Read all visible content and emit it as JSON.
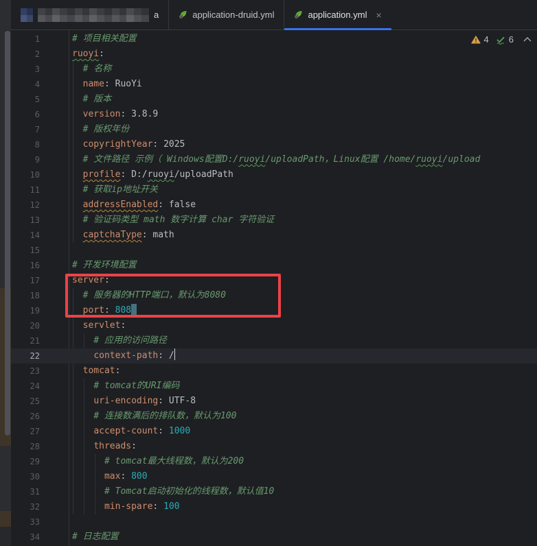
{
  "colors": {
    "editor_bg": "#1e1f22",
    "tab_accent": "#3574f0",
    "annotation_red": "#ee4247",
    "spring_green": "#6db33f",
    "key_orange": "#cf8e6d",
    "number_cyan": "#2aacb8",
    "comment_green": "#689a70",
    "warning_yellow": "#d8a04a",
    "typo_check_green": "#57a05a"
  },
  "tabs": {
    "censored": {
      "trailing_text": "a"
    },
    "items": [
      {
        "label": "application-druid.yml",
        "active": false
      },
      {
        "label": "application.yml",
        "active": true
      }
    ],
    "close_label": "×"
  },
  "inspections": {
    "warnings": "4",
    "typos": "6"
  },
  "code": {
    "lines": [
      {
        "n": 1,
        "pad": 0,
        "segs": [
          {
            "t": "# 项目相关配置",
            "c": "comment"
          }
        ]
      },
      {
        "n": 2,
        "pad": 0,
        "segs": [
          {
            "t": "ruoyi",
            "c": "key",
            "u": "typo"
          },
          {
            "t": ":",
            "c": "punct"
          }
        ]
      },
      {
        "n": 3,
        "pad": 2,
        "segs": [
          {
            "t": "# 名称",
            "c": "comment"
          }
        ]
      },
      {
        "n": 4,
        "pad": 2,
        "segs": [
          {
            "t": "name",
            "c": "key"
          },
          {
            "t": ": ",
            "c": "punct"
          },
          {
            "t": "RuoYi",
            "c": "str"
          }
        ]
      },
      {
        "n": 5,
        "pad": 2,
        "segs": [
          {
            "t": "# 版本",
            "c": "comment"
          }
        ]
      },
      {
        "n": 6,
        "pad": 2,
        "segs": [
          {
            "t": "version",
            "c": "key"
          },
          {
            "t": ": ",
            "c": "punct"
          },
          {
            "t": "3.8.9",
            "c": "str"
          }
        ]
      },
      {
        "n": 7,
        "pad": 2,
        "segs": [
          {
            "t": "# 版权年份",
            "c": "comment"
          }
        ]
      },
      {
        "n": 8,
        "pad": 2,
        "segs": [
          {
            "t": "copyrightYear",
            "c": "key"
          },
          {
            "t": ": ",
            "c": "punct"
          },
          {
            "t": "2025",
            "c": "str"
          }
        ]
      },
      {
        "n": 9,
        "pad": 2,
        "segs": [
          {
            "t": "# 文件路径 示例（ Windows配置D:/",
            "c": "comment"
          },
          {
            "t": "ruoyi",
            "c": "comment",
            "u": "typo"
          },
          {
            "t": "/uploadPath，Linux配置 /home/",
            "c": "comment"
          },
          {
            "t": "ruoyi",
            "c": "comment",
            "u": "typo"
          },
          {
            "t": "/upload",
            "c": "comment"
          }
        ]
      },
      {
        "n": 10,
        "pad": 2,
        "segs": [
          {
            "t": "profile",
            "c": "key",
            "u": "warn"
          },
          {
            "t": ": ",
            "c": "punct"
          },
          {
            "t": "D:/",
            "c": "str"
          },
          {
            "t": "ruoyi",
            "c": "str",
            "u": "typo"
          },
          {
            "t": "/uploadPath",
            "c": "str"
          }
        ]
      },
      {
        "n": 11,
        "pad": 2,
        "segs": [
          {
            "t": "# 获取ip地址开关",
            "c": "comment"
          }
        ]
      },
      {
        "n": 12,
        "pad": 2,
        "segs": [
          {
            "t": "addressEnabled",
            "c": "key",
            "u": "warn"
          },
          {
            "t": ": ",
            "c": "punct"
          },
          {
            "t": "false",
            "c": "str"
          }
        ]
      },
      {
        "n": 13,
        "pad": 2,
        "segs": [
          {
            "t": "# 验证码类型 math 数字计算 char 字符验证",
            "c": "comment"
          }
        ]
      },
      {
        "n": 14,
        "pad": 2,
        "segs": [
          {
            "t": "captchaType",
            "c": "key",
            "u": "warn"
          },
          {
            "t": ": ",
            "c": "punct"
          },
          {
            "t": "math",
            "c": "str"
          }
        ]
      },
      {
        "n": 15,
        "pad": 0,
        "segs": []
      },
      {
        "n": 16,
        "pad": 0,
        "segs": [
          {
            "t": "# 开发环境配置",
            "c": "comment"
          }
        ]
      },
      {
        "n": 17,
        "pad": 0,
        "segs": [
          {
            "t": "server",
            "c": "key"
          },
          {
            "t": ":",
            "c": "punct"
          }
        ]
      },
      {
        "n": 18,
        "pad": 2,
        "segs": [
          {
            "t": "# 服务器的HTTP端口，默认为8080",
            "c": "comment"
          }
        ]
      },
      {
        "n": 19,
        "pad": 2,
        "sel": true,
        "segs": [
          {
            "t": "port",
            "c": "key"
          },
          {
            "t": ": ",
            "c": "punct"
          },
          {
            "t": "808",
            "c": "num"
          }
        ]
      },
      {
        "n": 20,
        "pad": 2,
        "segs": [
          {
            "t": "servlet",
            "c": "key"
          },
          {
            "t": ":",
            "c": "punct"
          }
        ]
      },
      {
        "n": 21,
        "pad": 4,
        "segs": [
          {
            "t": "# 应用的访问路径",
            "c": "comment"
          }
        ]
      },
      {
        "n": 22,
        "pad": 4,
        "current": true,
        "caret": true,
        "segs": [
          {
            "t": "context-path",
            "c": "key"
          },
          {
            "t": ": ",
            "c": "punct"
          },
          {
            "t": "/",
            "c": "str"
          }
        ]
      },
      {
        "n": 23,
        "pad": 2,
        "segs": [
          {
            "t": "tomcat",
            "c": "key"
          },
          {
            "t": ":",
            "c": "punct"
          }
        ]
      },
      {
        "n": 24,
        "pad": 4,
        "segs": [
          {
            "t": "# tomcat的URI编码",
            "c": "comment"
          }
        ]
      },
      {
        "n": 25,
        "pad": 4,
        "segs": [
          {
            "t": "uri-encoding",
            "c": "key"
          },
          {
            "t": ": ",
            "c": "punct"
          },
          {
            "t": "UTF-8",
            "c": "str"
          }
        ]
      },
      {
        "n": 26,
        "pad": 4,
        "segs": [
          {
            "t": "# 连接数满后的排队数，默认为100",
            "c": "comment"
          }
        ]
      },
      {
        "n": 27,
        "pad": 4,
        "segs": [
          {
            "t": "accept-count",
            "c": "key"
          },
          {
            "t": ": ",
            "c": "punct"
          },
          {
            "t": "1000",
            "c": "num"
          }
        ]
      },
      {
        "n": 28,
        "pad": 4,
        "segs": [
          {
            "t": "threads",
            "c": "key"
          },
          {
            "t": ":",
            "c": "punct"
          }
        ]
      },
      {
        "n": 29,
        "pad": 6,
        "segs": [
          {
            "t": "# tomcat最大线程数，默认为200",
            "c": "comment"
          }
        ]
      },
      {
        "n": 30,
        "pad": 6,
        "segs": [
          {
            "t": "max",
            "c": "key"
          },
          {
            "t": ": ",
            "c": "punct"
          },
          {
            "t": "800",
            "c": "num"
          }
        ]
      },
      {
        "n": 31,
        "pad": 6,
        "segs": [
          {
            "t": "# Tomcat启动初始化的线程数，默认值10",
            "c": "comment"
          }
        ]
      },
      {
        "n": 32,
        "pad": 6,
        "segs": [
          {
            "t": "min-spare",
            "c": "key"
          },
          {
            "t": ": ",
            "c": "punct"
          },
          {
            "t": "100",
            "c": "num"
          }
        ]
      },
      {
        "n": 33,
        "pad": 0,
        "segs": []
      },
      {
        "n": 34,
        "pad": 0,
        "segs": [
          {
            "t": "# 日志配置",
            "c": "comment"
          }
        ]
      }
    ]
  }
}
